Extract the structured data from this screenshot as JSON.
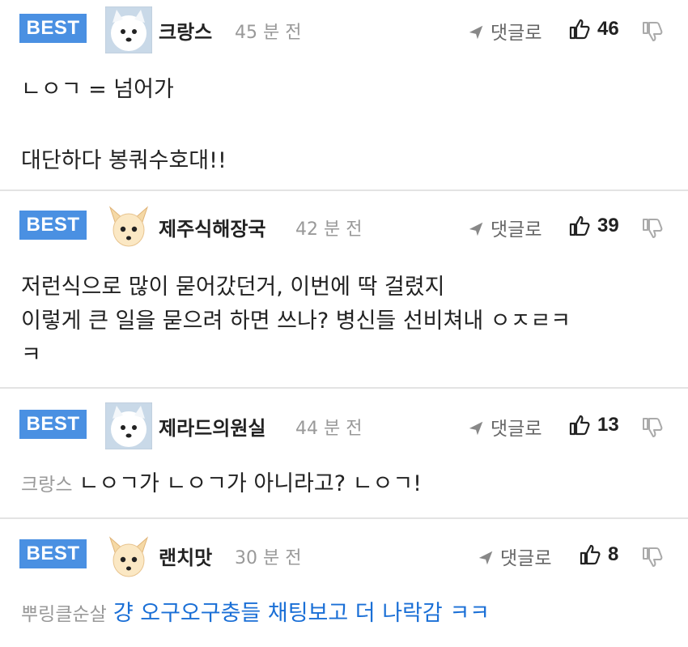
{
  "comments": [
    {
      "badge": "BEST",
      "avatar": "white-dog",
      "author": "크랑스",
      "time": "45 분 전",
      "reply_label": "댓글로",
      "likes": "46",
      "lines": [
        "ㄴㅇㄱ = 넘어가",
        "",
        "대단하다 봉쿼수호대!!"
      ]
    },
    {
      "badge": "BEST",
      "avatar": "fox-dog",
      "author": "제주식해장국",
      "time": "42 분 전",
      "reply_label": "댓글로",
      "likes": "39",
      "lines": [
        "저런식으로 많이 묻어갔던거, 이번에 딱 걸렸지",
        "이렇게 큰 일을 묻으려 하면 쓰나? 병신들 선비쳐내 ㅇㅈㄹㅋ",
        "ㅋ"
      ]
    },
    {
      "badge": "BEST",
      "avatar": "white-dog",
      "author": "제라드의원실",
      "time": "44 분 전",
      "reply_label": "댓글로",
      "likes": "13",
      "mention": "크랑스",
      "text": "ㄴㅇㄱ가 ㄴㅇㄱ가 아니라고? ㄴㅇㄱ!"
    },
    {
      "badge": "BEST",
      "avatar": "fox-dog",
      "author": "랜치맛",
      "time": "30 분 전",
      "reply_label": "댓글로",
      "likes": "8",
      "mention": "뿌링클순살",
      "text": "걍 오구오구충들 채팅보고 더 나락감 ㅋㅋ"
    }
  ],
  "colors": {
    "badge": "#4a90e2",
    "link": "#1a6fd6",
    "muted": "#999999"
  },
  "icons": {
    "reply": "reply-arrow-icon",
    "like": "thumbs-up-icon",
    "dislike": "thumbs-down-icon"
  }
}
